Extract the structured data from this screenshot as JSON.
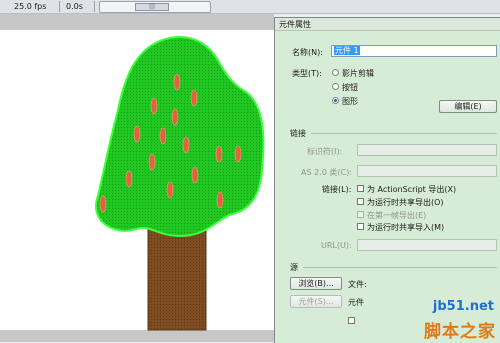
{
  "timeline": {
    "fps": "25.0 fps",
    "time": "0.0s"
  },
  "dialog": {
    "title": "元件属性",
    "name_label": "名称(N):",
    "name_value": "元件 1",
    "type_label": "类型(T):",
    "type_options": [
      "影片剪辑",
      "按钮",
      "图形"
    ],
    "type_selected": "图形",
    "edit_button": "编辑(E)",
    "linkage_section": "链接",
    "identifier_label": "标识符(I):",
    "as2_class_label": "AS 2.0 类(C):",
    "linkage_label": "链接(L):",
    "linkage_options": [
      {
        "label": "为 ActionScript 导出(X)",
        "enabled": true
      },
      {
        "label": "为运行时共享导出(O)",
        "enabled": true
      },
      {
        "label": "在第一帧导出(E)",
        "enabled": false
      },
      {
        "label": "为运行时共享导入(M)",
        "enabled": true
      }
    ],
    "url_label": "URL(U):",
    "source_section": "源",
    "browse_button": "浏览(B)...",
    "file_label": "文件:",
    "symbol_button": "元件(S)...",
    "symbol_label": "元件"
  },
  "watermark": {
    "site": "jb51.net",
    "brand": "脚本之家"
  },
  "colors": {
    "canopy": "#1fc21f",
    "canopy_outline": "#36ff36",
    "fruit": "#d9623b",
    "trunk": "#7a4a1e"
  }
}
